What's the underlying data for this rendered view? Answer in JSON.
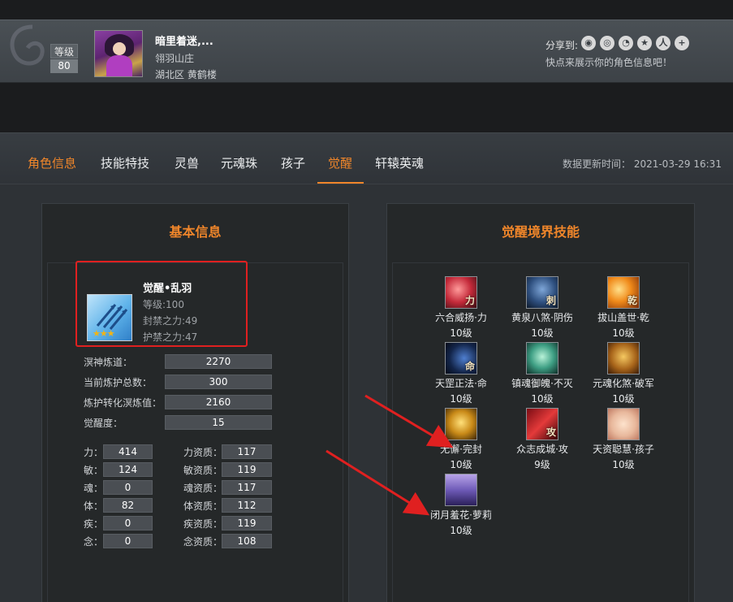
{
  "header": {
    "level_label": "等级",
    "level_value": "80",
    "player_name": "暗里着迷,...",
    "guild": "翎羽山庄",
    "server": "湖北区 黄鹤楼",
    "share_label": "分享到:",
    "share_icons": [
      "wechat-icon",
      "qzone-icon",
      "weibo-icon",
      "star-icon",
      "renren-icon",
      "plus-icon"
    ],
    "share_sub": "快点来展示你的角色信息吧！"
  },
  "tabs": [
    {
      "label": "角色信息",
      "state": "highlighted"
    },
    {
      "label": "技能特技",
      "state": "normal"
    },
    {
      "label": "灵兽",
      "state": "normal"
    },
    {
      "label": "元魂珠",
      "state": "normal"
    },
    {
      "label": "孩子",
      "state": "normal"
    },
    {
      "label": "觉醒",
      "state": "selected"
    },
    {
      "label": "轩辕英魂",
      "state": "normal"
    }
  ],
  "update_time": "数据更新时间： 2021-03-29 16:31",
  "basic_info": {
    "title": "基本信息",
    "skill_name": "觉醒•乱羽",
    "level": "等级:100",
    "seal_power": "封禁之力:49",
    "guard_power": "护禁之力:47",
    "stars": "★★★",
    "stats": [
      {
        "label": "溟神炼道：",
        "value": "2270"
      },
      {
        "label": "当前炼护总数：",
        "value": "300"
      },
      {
        "label": "炼护转化溟炼值：",
        "value": "2160"
      },
      {
        "label": "觉醒度：",
        "value": "15"
      }
    ],
    "attributes": [
      {
        "label": "力：",
        "value": "414",
        "apt_label": "力资质：",
        "apt_value": "117"
      },
      {
        "label": "敏：",
        "value": "124",
        "apt_label": "敏资质：",
        "apt_value": "119"
      },
      {
        "label": "魂：",
        "value": "0",
        "apt_label": "魂资质：",
        "apt_value": "117"
      },
      {
        "label": "体：",
        "value": "82",
        "apt_label": "体资质：",
        "apt_value": "112"
      },
      {
        "label": "疾：",
        "value": "0",
        "apt_label": "疾资质：",
        "apt_value": "119"
      },
      {
        "label": "念：",
        "value": "0",
        "apt_label": "念资质：",
        "apt_value": "108"
      }
    ]
  },
  "awakening": {
    "title": "觉醒境界技能",
    "skills": [
      {
        "name": "六合威扬·力",
        "level": "10级",
        "glyph": "力"
      },
      {
        "name": "黄泉八煞·阴伤",
        "level": "10级",
        "glyph": "刺"
      },
      {
        "name": "拔山盖世·乾",
        "level": "10级",
        "glyph": "乾"
      },
      {
        "name": "天罡正法·命",
        "level": "10级",
        "glyph": "命"
      },
      {
        "name": "镇魂御魄·不灭",
        "level": "10级",
        "glyph": ""
      },
      {
        "name": "元魂化煞·破军",
        "level": "10级",
        "glyph": ""
      },
      {
        "name": "无懈·完封",
        "level": "10级",
        "glyph": ""
      },
      {
        "name": "众志成城·攻",
        "level": "9级",
        "glyph": "攻"
      },
      {
        "name": "天资聪慧·孩子",
        "level": "10级",
        "glyph": ""
      },
      {
        "name": "闭月羞花·萝莉",
        "level": "10级",
        "glyph": ""
      }
    ]
  },
  "colors": {
    "accent": "#f0862a",
    "annotation_red": "#e02020"
  }
}
